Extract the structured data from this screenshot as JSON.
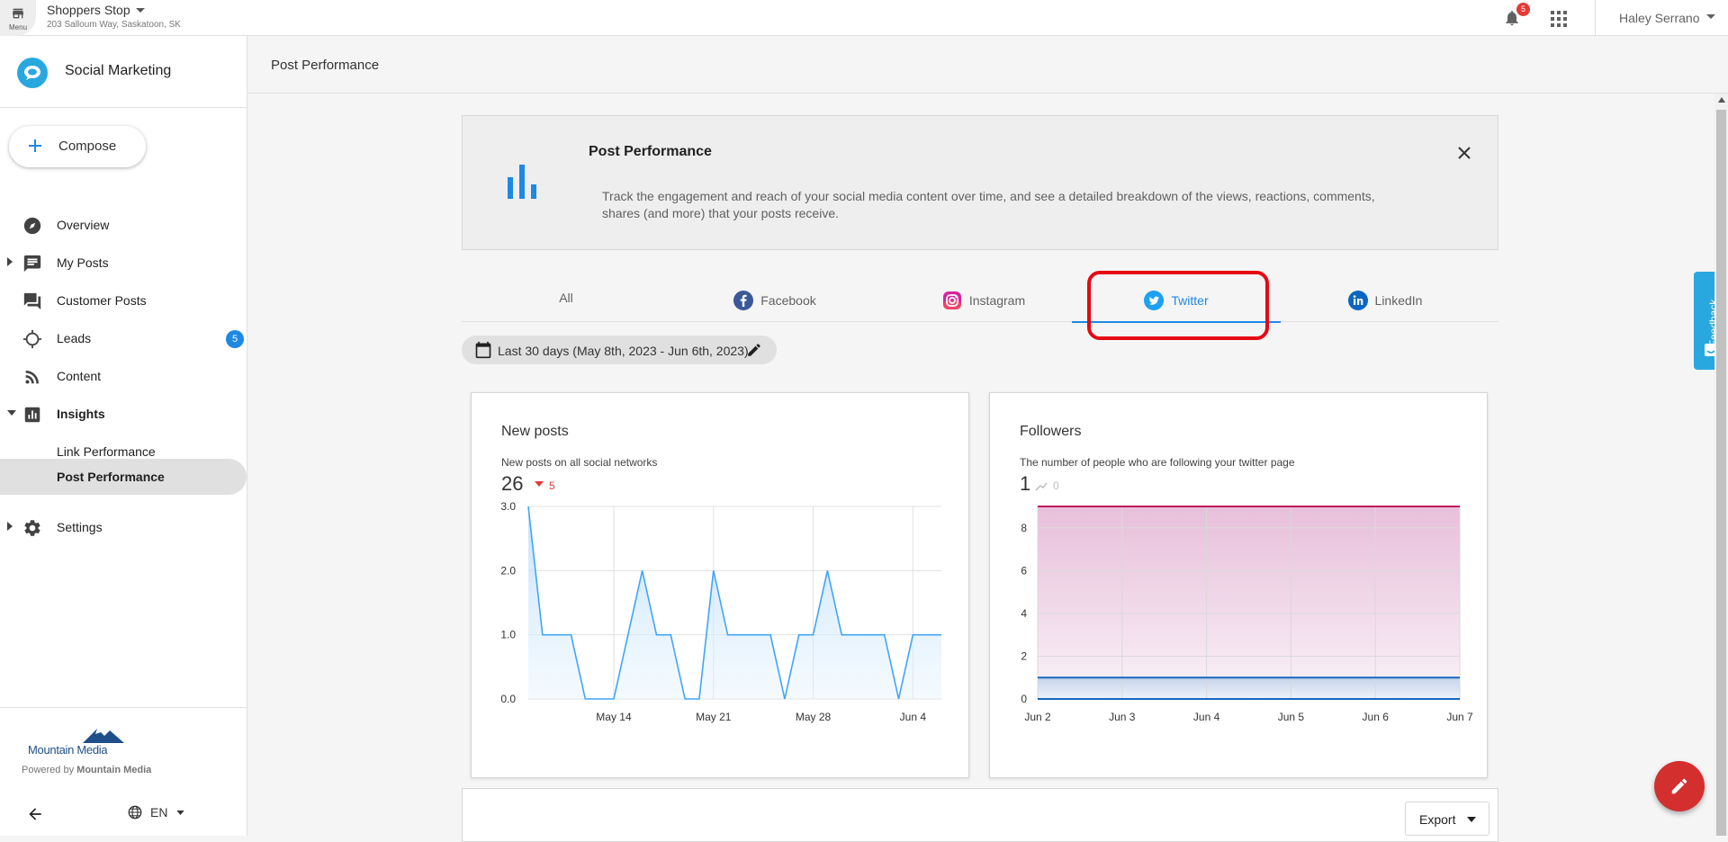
{
  "topbar": {
    "menu_label": "Menu",
    "business_name": "Shoppers Stop",
    "business_address": "203 Salloum Way, Saskatoon, SK",
    "notification_count": "5",
    "user_name": "Haley Serrano"
  },
  "sidebar": {
    "brand_title": "Social Marketing",
    "compose_label": "Compose",
    "items": [
      {
        "label": "Overview",
        "icon": "compass-icon"
      },
      {
        "label": "My Posts",
        "icon": "message-icon"
      },
      {
        "label": "Customer Posts",
        "icon": "forum-icon"
      },
      {
        "label": "Leads",
        "icon": "crosshair-icon",
        "badge": "5"
      },
      {
        "label": "Content",
        "icon": "rss-icon"
      },
      {
        "label": "Insights",
        "icon": "insights-icon"
      },
      {
        "label": "Link Performance"
      },
      {
        "label": "Post Performance"
      },
      {
        "label": "Settings",
        "icon": "gear-icon"
      }
    ],
    "footer_logo_text": "Mountain Media",
    "powered_prefix": "Powered by ",
    "powered_brand": "Mountain Media",
    "language": "EN"
  },
  "page": {
    "header_title": "Post Performance"
  },
  "banner": {
    "title": "Post Performance",
    "description": "Track the engagement and reach of your social media content over time, and see a detailed breakdown of the views, reactions, comments, shares (and more) that your posts receive."
  },
  "tabs": [
    {
      "label": "All",
      "icon": ""
    },
    {
      "label": "Facebook",
      "icon": "facebook-icon"
    },
    {
      "label": "Instagram",
      "icon": "instagram-icon"
    },
    {
      "label": "Twitter",
      "icon": "twitter-icon",
      "active": true
    },
    {
      "label": "LinkedIn",
      "icon": "linkedin-icon"
    }
  ],
  "date_filter": {
    "label": "Last 30 days (May 8th, 2023 - Jun 6th, 2023)"
  },
  "cards": {
    "new_posts": {
      "title": "New posts",
      "subtitle": "New posts on all social networks",
      "value": "26",
      "delta": "5",
      "delta_direction": "down",
      "delta_color": "#e53935"
    },
    "followers": {
      "title": "Followers",
      "subtitle": "The number of people who are following your twitter page",
      "value": "1",
      "delta": "0",
      "delta_color": "#bdbdbd"
    }
  },
  "export_label": "Export",
  "feedback_label": "Feedback",
  "colors": {
    "accent": "#1e88e5",
    "highlight": "#e50914",
    "fab": "#d32f2f"
  },
  "chart_data": [
    {
      "type": "area",
      "xlabel": "",
      "ylabel": "",
      "ylim": [
        0,
        3
      ],
      "yticks": [
        "0.0",
        "1.0",
        "2.0",
        "3.0"
      ],
      "xticks": [
        "May 14",
        "May 21",
        "May 28",
        "Jun 4"
      ],
      "x": [
        "May 8",
        "May 9",
        "May 10",
        "May 11",
        "May 12",
        "May 13",
        "May 14",
        "May 15",
        "May 16",
        "May 17",
        "May 18",
        "May 19",
        "May 20",
        "May 21",
        "May 22",
        "May 23",
        "May 24",
        "May 25",
        "May 26",
        "May 27",
        "May 28",
        "May 29",
        "May 30",
        "May 31",
        "Jun 1",
        "Jun 2",
        "Jun 3",
        "Jun 4",
        "Jun 5",
        "Jun 6"
      ],
      "series": [
        {
          "values": [
            3,
            1,
            1,
            1,
            0,
            0,
            0,
            1,
            2,
            1,
            1,
            0,
            0,
            2,
            1,
            1,
            1,
            1,
            0,
            1,
            1,
            2,
            1,
            1,
            1,
            1,
            0,
            1,
            1,
            1
          ],
          "color": "#42a5f5"
        }
      ],
      "grid": true
    },
    {
      "type": "area",
      "xlabel": "",
      "ylabel": "",
      "ylim": [
        0,
        9
      ],
      "yticks": [
        "0",
        "2",
        "4",
        "6",
        "8"
      ],
      "xticks": [
        "Jun 2",
        "Jun 3",
        "Jun 4",
        "Jun 5",
        "Jun 6",
        "Jun 7"
      ],
      "x": [
        "Jun 2",
        "Jun 3",
        "Jun 4",
        "Jun 5",
        "Jun 6",
        "Jun 7"
      ],
      "series": [
        {
          "values": [
            9,
            9,
            9,
            9,
            9,
            9
          ],
          "color": "#c2185b"
        },
        {
          "values": [
            1,
            1,
            1,
            1,
            1,
            1
          ],
          "color": "#1565c0"
        },
        {
          "values": [
            0,
            0,
            0,
            0,
            0,
            0
          ],
          "color": "#1565c0"
        }
      ],
      "grid": true
    }
  ]
}
